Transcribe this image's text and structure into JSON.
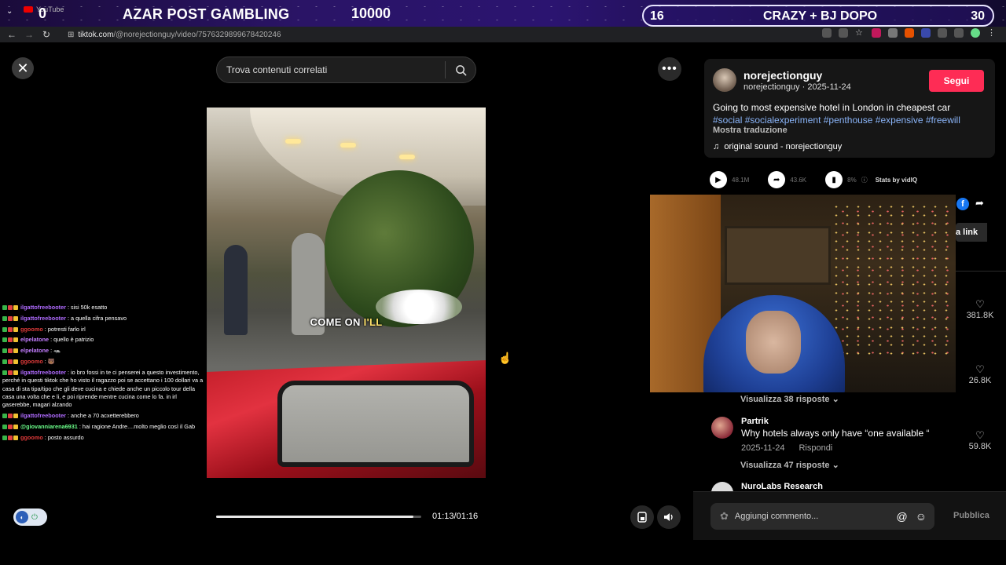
{
  "stream": {
    "yt_label": "YouTube",
    "left_count": "0",
    "title": "AZAR POST GAMBLING",
    "center_count": "10000",
    "pill_left": "16",
    "pill_text": "CRAZY + BJ DOPO",
    "pill_right": "30"
  },
  "browser": {
    "url_host": "tiktok.com",
    "url_path": "/@norejectionguy/video/7576329899678420246"
  },
  "page": {
    "search_placeholder": "Trova contenuti correlati",
    "caption_a": "COME ON ",
    "caption_b": "I'LL",
    "time": "01:13/01:16",
    "progress": 0.96
  },
  "chat": [
    {
      "user": "ilgattofreebooter",
      "user_color": "#b06bff",
      "text": ": sisi 50k esatto"
    },
    {
      "user": "ilgattofreebooter",
      "user_color": "#b06bff",
      "text": ": a quella cifra pensavo"
    },
    {
      "user": "ggoomo",
      "user_color": "#e03a3a",
      "text": ": potresti farlo irl"
    },
    {
      "user": "elpelatone",
      "user_color": "#c37dff",
      "text": ": quello è patrizio"
    },
    {
      "user": "elpelatone",
      "user_color": "#c37dff",
      "text": ": 🦡"
    },
    {
      "user": "ggoomo",
      "user_color": "#e03a3a",
      "text": ": 🐻"
    },
    {
      "user": "ilgattofreebooter",
      "user_color": "#b06bff",
      "text": ": io bro fossi in te ci penserei a questo investimento, perché in questi tiktok che ho visto il ragazzo poi se accettano i 100 dollari va a casa di sta tipa/tipo che gli deve cucina e chiede anche un piccolo tour della casa una volta che e li, e poi riprende mentre cucina come lo fa. in irl gaserebbe, magari alzando"
    },
    {
      "user": "ilgattofreebooter",
      "user_color": "#b06bff",
      "text": ": anche a 70 acxetterebbero"
    },
    {
      "user": "@giovanniarena6931",
      "user_color": "#6bff8a",
      "text": ": hai ragione Andre....molto meglio così il Gab"
    },
    {
      "user": "ggoomo",
      "user_color": "#e03a3a",
      "text": ": posto assurdo"
    }
  ],
  "post": {
    "username": "norejectionguy",
    "meta": "norejectionguy · 2025-11-24",
    "follow": "Segui",
    "description": "Going to most expensive hotel in London in cheapest car",
    "tags": "#social #socialexperiment #penthouse #expensive #freewill",
    "translate": "Mostra traduzione",
    "sound": "original sound - norejectionguy",
    "plays": "48.1M",
    "shares": "43.6K",
    "percent": "8%",
    "stats_label": "Stats by vidIQ",
    "facebook": "f",
    "copy_link": "a link"
  },
  "likes": [
    "381.8K",
    "26.8K",
    "59.8K"
  ],
  "comments": [
    {
      "replies": "Visualizza 38 risposte"
    },
    {
      "name": "Partrik",
      "text": "Why hotels always only have “one available “",
      "date": "2025-11-24",
      "reply": "Rispondi",
      "replies": "Visualizza 47 risposte"
    },
    {
      "name": "NuroLabs Research"
    }
  ],
  "composer": {
    "placeholder": "Aggiungi commento...",
    "publish": "Pubblica"
  }
}
